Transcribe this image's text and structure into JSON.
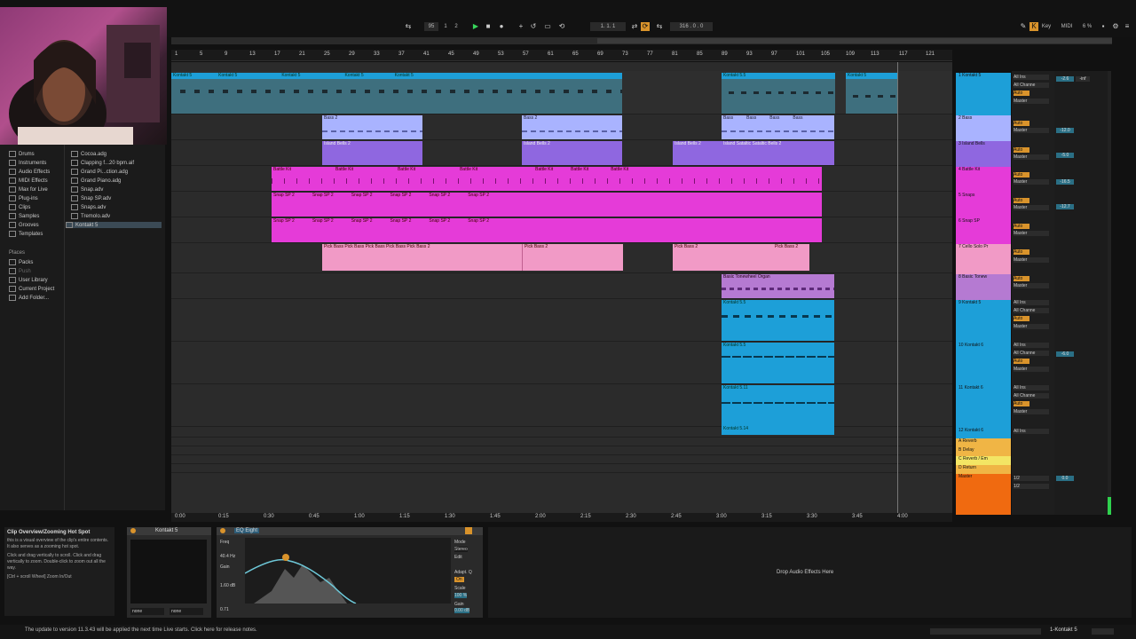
{
  "transport": {
    "tempo": "95",
    "sig_num": "1",
    "sig_den": "2",
    "position": "1.  1.  1",
    "end": "316 . 0 . 0",
    "key_label": "Key",
    "midi_label": "MIDI",
    "cpu": "6 %"
  },
  "ruler": [
    "1",
    "5",
    "9",
    "13",
    "17",
    "21",
    "25",
    "29",
    "33",
    "37",
    "41",
    "45",
    "49",
    "53",
    "57",
    "61",
    "65",
    "69",
    "73",
    "77",
    "81",
    "85",
    "89",
    "93",
    "97",
    "101",
    "105",
    "109",
    "113",
    "117",
    "121"
  ],
  "timebar": [
    "0:00",
    "0:15",
    "0:30",
    "0:45",
    "1:00",
    "1:15",
    "1:30",
    "1:45",
    "2:00",
    "2:15",
    "2:30",
    "2:45",
    "3:00",
    "3:15",
    "3:30",
    "3:45",
    "4:00"
  ],
  "browser": {
    "categories": [
      "Drums",
      "Instruments",
      "Audio Effects",
      "MIDI Effects",
      "Max for Live",
      "Plug-ins",
      "Clips",
      "Samples",
      "Grooves",
      "Templates"
    ],
    "places_title": "Places",
    "places": [
      "Packs",
      "Push",
      "User Library",
      "Current Project",
      "Add Folder..."
    ],
    "files": [
      "Cocoa.adg",
      "Clapping f...20 bpm.aif",
      "Grand Pi...ction.adg",
      "Grand Piano.adg",
      "Snap.adv",
      "Snap SP.adv",
      "Snaps.adv",
      "Tremolo.adv",
      "Kontakt 5"
    ]
  },
  "clips": {
    "kontakt": [
      "Kontakt 5",
      "Kontakt 5",
      "Kontakt 5",
      "Kontakt 5",
      "Kontakt 5",
      "Kontakt 5.5",
      "Kontakt 5"
    ],
    "bass": [
      "Bass 2",
      "Bass 2",
      "Bass",
      "Bass",
      "Bass",
      "Bass"
    ],
    "island": [
      "Island Bells 2",
      "Island Bells 2",
      "Island Bells 2",
      "Island Sataltic Sataltic Bells 2"
    ],
    "battle": [
      "Battle Kit",
      "Battle Kit",
      "Battle Kit",
      "Battle Kit",
      "Battle Kit",
      "Battle Kit",
      "Battle Kit"
    ],
    "snap": [
      "Snap SP 2",
      "Snap SP 2",
      "Snap SP 2",
      "Snap SP 2",
      "Snap SP 2",
      "Snap SP 2",
      "Snap SP 2",
      "Snap SP 2",
      "Snap SP 2",
      "Snap SP 2",
      "Snap SP 2",
      "Snap SP 2"
    ],
    "pick": [
      "Pick Bass Pick Bass Pick Bass Pick Bass Pick Bass 2",
      "Pick Bass 2",
      "Pick Bass 2",
      "Pick Bass 2"
    ],
    "organ": "Basic Tonewheel Organ",
    "k9": "Kontakt 5.5",
    "k10": "Kontakt 5.5",
    "k11": "Kontakt 5.11",
    "k12": "Kontakt 5.14"
  },
  "tracks": [
    {
      "name": "1 Kontakt 5",
      "color": "#1d9fd8"
    },
    {
      "name": "2 Bass",
      "color": "#a9b3ff"
    },
    {
      "name": "3 Island Bells",
      "color": "#8f67e0"
    },
    {
      "name": "4 Battle Kit",
      "color": "#e53bd8"
    },
    {
      "name": "5 Snaps",
      "color": "#e53bd8"
    },
    {
      "name": "6 Snap SP",
      "color": "#e53bd8"
    },
    {
      "name": "7 Cello Solo Pr",
      "color": "#f19ac6"
    },
    {
      "name": "8 Basic Tonew",
      "color": "#b57ad2"
    },
    {
      "name": "9 Kontakt 5",
      "color": "#1d9fd8"
    },
    {
      "name": "10 Kontakt 6",
      "color": "#1d9fd8"
    },
    {
      "name": "11 Kontakt 6",
      "color": "#1d9fd8"
    },
    {
      "name": "12 Kontakt 6",
      "color": "#1d9fd8"
    }
  ],
  "returns": [
    {
      "name": "A Reverb",
      "color": "#f0b545"
    },
    {
      "name": "B Delay",
      "color": "#f0b545"
    },
    {
      "name": "C Reverb / Em",
      "color": "#f3e564"
    },
    {
      "name": "D Return",
      "color": "#f0b545"
    }
  ],
  "master": {
    "name": "Master",
    "color": "#f06a10"
  },
  "io": {
    "all_ins": "All Ins",
    "all_channels": "All Channe",
    "auto": "Auto",
    "off": "Off",
    "in": "In",
    "master": "Master",
    "out_master": "1/2"
  },
  "mixer_values": [
    "-2.6",
    "-inf",
    "-inf",
    "-12.0",
    "-inf",
    "-5.0",
    "-inf",
    "-16.5",
    "-inf",
    "-inf",
    "-inf",
    "-12.7",
    "-6.0",
    "-inf",
    "0.0"
  ],
  "help": {
    "title": "Clip Overview/Zooming Hot Spot",
    "p1": "this is a visual overview of the clip's entire contents. It also serves as a zooming hot spot.",
    "p2": "Click and drag vertically to scroll. Click and drag vertically to zoom. Double-click to zoom out all the way.",
    "p3": "[Ctrl + scroll Wheel] Zoom In/Out"
  },
  "device1": {
    "title": "Kontakt 5",
    "sel1": "none",
    "sel2": "none"
  },
  "device2": {
    "title": "EQ Eight",
    "freq_label": "Freq",
    "freq": "40.4 Hz",
    "gain_label": "Gain",
    "gain": "1.60 dB",
    "q": "0.71",
    "mode_label": "Mode",
    "mode": "Stereo",
    "edit_label": "Edit",
    "adapt_label": "Adapt. Q",
    "adapt": "On",
    "scale_label": "Scale",
    "scale": "100 %",
    "gain_out_label": "Gain",
    "gain_out": "0.00 dB"
  },
  "dropzone_text": "Drop Audio Effects Here",
  "status_text": "The update to version 11.3.43 will be applied the next time Live starts. Click here for release notes.",
  "status_right": "1-Kontakt 5"
}
